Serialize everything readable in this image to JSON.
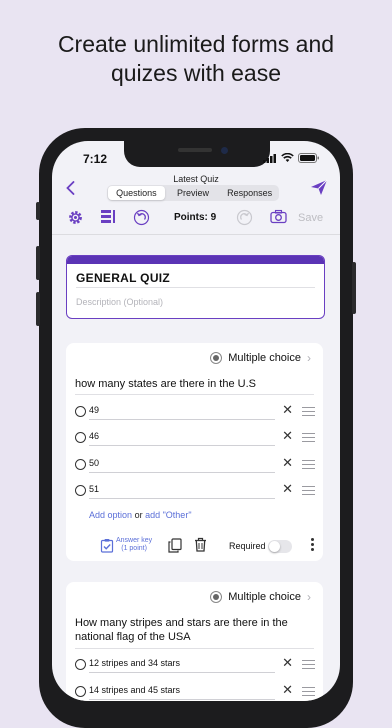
{
  "headline": {
    "line1": "Create unlimited forms and",
    "line2": "quizes with ease"
  },
  "status": {
    "time": "7:12"
  },
  "nav": {
    "title": "Latest Quiz",
    "tabs": [
      "Questions",
      "Preview",
      "Responses"
    ],
    "active_tab": "Questions"
  },
  "toolbar": {
    "points": "Points: 9",
    "save": "Save"
  },
  "form": {
    "title": "GENERAL QUIZ",
    "description_placeholder": "Description (Optional)"
  },
  "question1": {
    "type": "Multiple choice",
    "text": "how many states are there in the U.S",
    "options": [
      "49",
      "46",
      "50",
      "51"
    ],
    "add_option": "Add option",
    "or": "or",
    "add_other": "add \"Other\"",
    "answer_key": "Answer key",
    "answer_points": "(1 point)",
    "required": "Required"
  },
  "question2": {
    "type": "Multiple choice",
    "text_line1": "How many stripes and stars are there in the",
    "text_line2": "national flag of the USA",
    "options": [
      "12 stripes and 34 stars",
      "14 stripes and 45 stars"
    ]
  },
  "colors": {
    "accent": "#6a3fc2",
    "link": "#5b6fd8",
    "background": "#e9e4f2"
  }
}
